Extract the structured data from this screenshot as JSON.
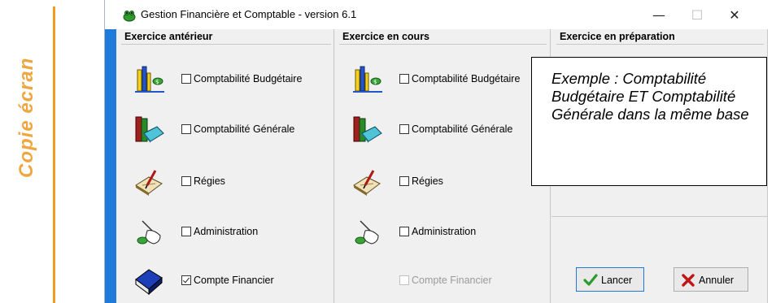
{
  "side_caption": "Copie écran",
  "window": {
    "title": "Gestion Financière et Comptable - version 6.1",
    "controls": {
      "minimize": "—",
      "maximize": "☐",
      "close": "✕"
    }
  },
  "columns": [
    {
      "header": "Exercice antérieur",
      "items": [
        {
          "label": "Comptabilité Budgétaire",
          "icon": "budget-scales-icon",
          "checked": false
        },
        {
          "label": "Comptabilité Générale",
          "icon": "books-icon",
          "checked": false
        },
        {
          "label": "Régies",
          "icon": "quill-book-icon",
          "checked": false
        },
        {
          "label": "Administration",
          "icon": "hand-pointer-icon",
          "checked": false
        },
        {
          "label": "Compte Financier",
          "icon": "blue-book-icon",
          "checked": true
        }
      ]
    },
    {
      "header": "Exercice en cours",
      "items": [
        {
          "label": "Comptabilité Budgétaire",
          "icon": "budget-scales-icon",
          "checked": false
        },
        {
          "label": "Comptabilité Générale",
          "icon": "books-icon",
          "checked": false
        },
        {
          "label": "Régies",
          "icon": "quill-book-icon",
          "checked": false
        },
        {
          "label": "Administration",
          "icon": "hand-pointer-icon",
          "checked": false
        },
        {
          "label": "Compte Financier",
          "checked": false,
          "disabled": true
        }
      ]
    },
    {
      "header": "Exercice en préparation"
    }
  ],
  "buttons": {
    "launch": "Lancer",
    "cancel": "Annuler"
  },
  "callout": "Exemple : Comptabilité Budgétaire ET Comptabilité Générale dans la même base",
  "colors": {
    "accent_strip": "#1e7bd9",
    "side_caption": "#f0a640",
    "orange_rule": "#f29a1b"
  }
}
